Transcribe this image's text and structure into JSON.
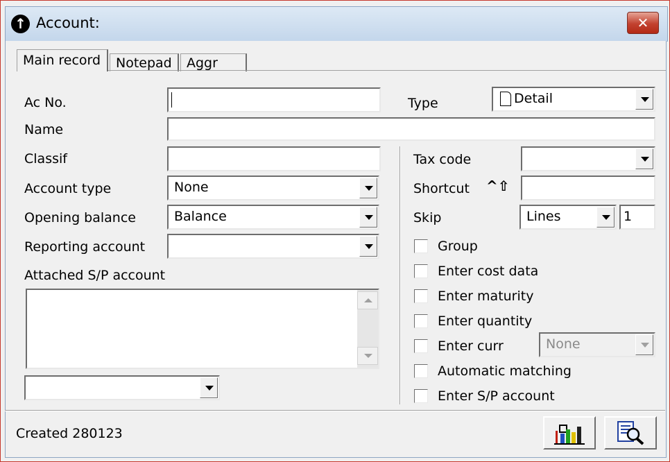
{
  "window": {
    "title": "Account:",
    "close_glyph": "✕",
    "icon_glyph": "↑"
  },
  "tabs": [
    {
      "label": "Main record",
      "active": true
    },
    {
      "label": "Notepad",
      "active": false
    },
    {
      "label": "Aggr",
      "active": false
    }
  ],
  "form": {
    "ac_no": {
      "label": "Ac No.",
      "value": ""
    },
    "type": {
      "label": "Type",
      "value": "Detail",
      "icon": "document-icon"
    },
    "name": {
      "label": "Name",
      "value": ""
    },
    "classif": {
      "label": "Classif",
      "value": ""
    },
    "account_type": {
      "label": "Account type",
      "value": "None"
    },
    "opening_balance": {
      "label": "Opening balance",
      "value": "Balance"
    },
    "reporting_account": {
      "label": "Reporting account",
      "value": ""
    },
    "attached_sp": {
      "label": "Attached S/P account",
      "list_items": [],
      "dropdown_value": ""
    },
    "tax_code": {
      "label": "Tax code",
      "value": ""
    },
    "shortcut": {
      "label": "Shortcut",
      "value": "",
      "key_glyph": "^⇧"
    },
    "skip": {
      "label": "Skip",
      "unit": "Lines",
      "count": "1"
    }
  },
  "checkboxes": [
    {
      "label": "Group",
      "checked": false
    },
    {
      "label": "Enter cost data",
      "checked": false
    },
    {
      "label": "Enter maturity",
      "checked": false
    },
    {
      "label": "Enter quantity",
      "checked": false
    },
    {
      "label": "Enter curr",
      "checked": false
    },
    {
      "label": "Automatic matching",
      "checked": false
    },
    {
      "label": "Enter S/P account",
      "checked": false
    }
  ],
  "currency_select": {
    "value": "None",
    "disabled": true
  },
  "status": {
    "text": "Created 280123"
  },
  "toolbar": {
    "chart_icon": "bar-chart-icon",
    "inspect_icon": "inspect-document-icon"
  },
  "colors": {
    "window_border": "#c6382c",
    "titlebar": "#c3d6eb",
    "close_button": "#c2412f",
    "face": "#f0f0f0"
  }
}
